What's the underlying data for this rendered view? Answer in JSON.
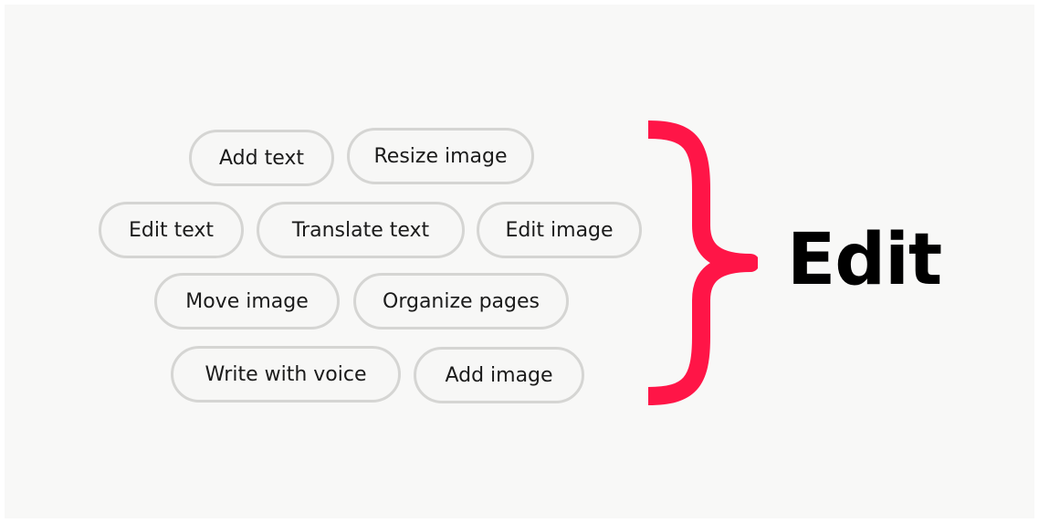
{
  "actions": [
    {
      "id": "add-text",
      "label": "Add text"
    },
    {
      "id": "resize-image",
      "label": "Resize image"
    },
    {
      "id": "edit-text",
      "label": "Edit text"
    },
    {
      "id": "translate-text",
      "label": "Translate text"
    },
    {
      "id": "edit-image",
      "label": "Edit image"
    },
    {
      "id": "move-image",
      "label": "Move image"
    },
    {
      "id": "organize-pages",
      "label": "Organize pages"
    },
    {
      "id": "write-with-voice",
      "label": "Write with voice"
    },
    {
      "id": "add-image",
      "label": "Add image"
    }
  ],
  "group": {
    "label": "Edit",
    "brace_color": "#ff1547",
    "brace_icon": "right-curly-brace"
  }
}
